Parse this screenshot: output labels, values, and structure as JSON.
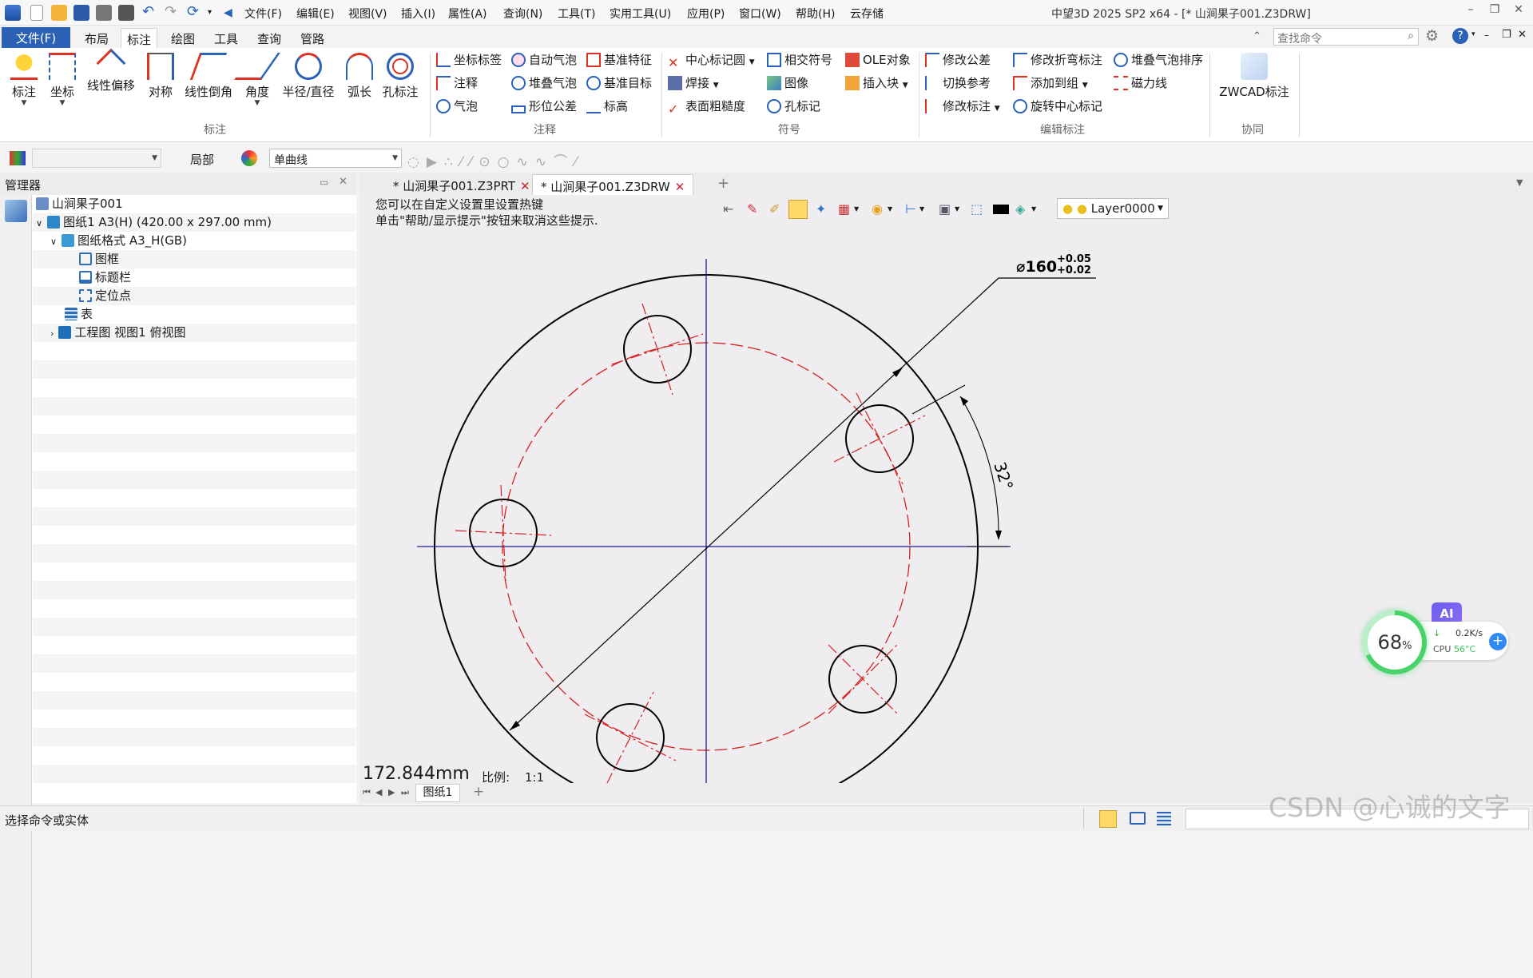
{
  "titlebar": {
    "menus": [
      "文件(F)",
      "编辑(E)",
      "视图(V)",
      "插入(I)",
      "属性(A)",
      "查询(N)",
      "工具(T)",
      "实用工具(U)",
      "应用(P)",
      "窗口(W)",
      "帮助(H)",
      "云存储"
    ],
    "window_title": "中望3D 2025 SP2 x64 - [* 山涧果子001.Z3DRW]"
  },
  "tabs": [
    "文件(F)",
    "布局",
    "标注",
    "绘图",
    "工具",
    "查询",
    "管路"
  ],
  "search": {
    "placeholder": "查找命令"
  },
  "ribbon": {
    "big_buttons": [
      "标注",
      "坐标",
      "线性偏移",
      "对称",
      "线性倒角",
      "角度",
      "半径/直径",
      "弧长",
      "孔标注"
    ],
    "annotate_col1": [
      "坐标标签",
      "注释",
      "气泡"
    ],
    "annotate_col2": [
      "自动气泡",
      "堆叠气泡",
      "形位公差"
    ],
    "annotate_col3": [
      "基准特征",
      "基准目标",
      "标高"
    ],
    "symbol_col1": [
      "中心标记圆",
      "焊接",
      "表面粗糙度"
    ],
    "symbol_col2": [
      "相交符号",
      "图像",
      "孔标记"
    ],
    "symbol_col3": [
      "OLE对象",
      "插入块"
    ],
    "edit_col1": [
      "修改公差",
      "切换参考",
      "修改标注"
    ],
    "edit_col2": [
      "修改折弯标注",
      "添加到组",
      "旋转中心标记"
    ],
    "edit_col3": [
      "堆叠气泡排序",
      "磁力线"
    ],
    "collab_button": "ZWCAD标注",
    "groups": [
      "标注",
      "注释",
      "符号",
      "编辑标注",
      "协同"
    ]
  },
  "toolrow": {
    "scope": "局部",
    "curve_type": "单曲线"
  },
  "manager": {
    "title": "管理器",
    "tree": [
      {
        "label": "山涧果子001",
        "indent": 0
      },
      {
        "label": "图纸1 A3(H) (420.00 x 297.00 mm)",
        "indent": 1
      },
      {
        "label": "图纸格式 A3_H(GB)",
        "indent": 2
      },
      {
        "label": "图框",
        "indent": 3
      },
      {
        "label": "标题栏",
        "indent": 3
      },
      {
        "label": "定位点",
        "indent": 3
      },
      {
        "label": "表",
        "indent": 2
      },
      {
        "label": "工程图 视图1 俯视图",
        "indent": 2
      }
    ]
  },
  "doc_tabs": [
    "* 山涧果子001.Z3PRT",
    "* 山涧果子001.Z3DRW"
  ],
  "canvas": {
    "hint_line1": "您可以在自定义设置里设置热键",
    "hint_line2": "单击\"帮助/显示提示\"按钮来取消这些提示.",
    "layer": "Layer0000",
    "dim_diameter": "⌀160",
    "tol_upper": "+0.05",
    "tol_lower": "+0.02",
    "angle": "32°",
    "measure": "172.844mm",
    "scale_label": "比例:",
    "scale_value": "1:1"
  },
  "sheet_tabs": [
    "图纸1"
  ],
  "status": {
    "prompt": "选择命令或实体"
  },
  "widget": {
    "ai": "AI",
    "percent": "68",
    "percent_unit": "%",
    "speed": "0.2K/s",
    "cpu_label": "CPU",
    "cpu_temp": "56°C"
  },
  "watermark": "CSDN @心诚的文字",
  "colors": {
    "accent": "#2b62b8",
    "center_line": "#1b1b9a",
    "hidden_line": "#d62020"
  }
}
